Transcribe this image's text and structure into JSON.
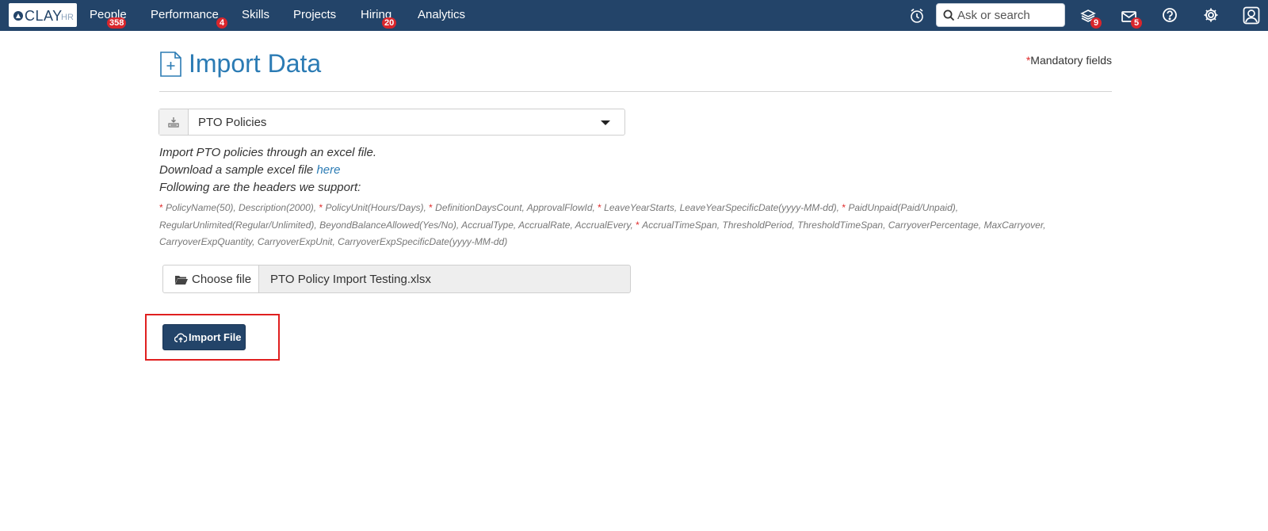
{
  "app": {
    "logo_text": "CLAY",
    "logo_suffix": "HR"
  },
  "nav": {
    "items": [
      {
        "label": "People",
        "badge": "358"
      },
      {
        "label": "Performance",
        "badge": "4"
      },
      {
        "label": "Skills",
        "badge": ""
      },
      {
        "label": "Projects",
        "badge": ""
      },
      {
        "label": "Hiring",
        "badge": "20"
      },
      {
        "label": "Analytics",
        "badge": ""
      }
    ],
    "search_placeholder": "Ask or search",
    "icons": [
      {
        "name": "alarm-clock-icon",
        "badge": ""
      },
      {
        "name": "layers-icon",
        "badge": "9"
      },
      {
        "name": "mail-icon",
        "badge": "5"
      },
      {
        "name": "help-icon",
        "badge": ""
      },
      {
        "name": "gear-icon",
        "badge": ""
      },
      {
        "name": "user-icon",
        "badge": ""
      }
    ]
  },
  "page": {
    "title": "Import Data",
    "mandatory_star": "*",
    "mandatory_label": "Mandatory fields"
  },
  "form": {
    "import_type": "PTO Policies",
    "desc_line1": "Import PTO policies through an excel file.",
    "desc_line2_prefix": "Download a sample excel file ",
    "desc_line2_link": "here",
    "desc_line3": "Following are the headers we support:",
    "headers": [
      {
        "required": true,
        "text": "PolicyName(50), "
      },
      {
        "required": false,
        "text": "Description(2000), "
      },
      {
        "required": true,
        "text": "PolicyUnit(Hours/Days), "
      },
      {
        "required": true,
        "text": "DefinitionDaysCount, ApprovalFlowId, "
      },
      {
        "required": true,
        "text": "LeaveYearStarts, LeaveYearSpecificDate(yyyy-MM-dd), "
      },
      {
        "required": true,
        "text": "PaidUnpaid(Paid/Unpaid), RegularUnlimited(Regular/Unlimited), BeyondBalanceAllowed(Yes/No), AccrualType, AccrualRate, AccrualEvery, "
      },
      {
        "required": true,
        "text": "AccrualTimeSpan, ThresholdPeriod, ThresholdTimeSpan, CarryoverPercentage, MaxCarryover, CarryoverExpQuantity, CarryoverExpUnit, CarryoverExpSpecificDate(yyyy-MM-dd)"
      }
    ],
    "choose_file_label": "Choose file",
    "file_name": "PTO Policy Import Testing.xlsx",
    "import_button_label": "Import File"
  },
  "colors": {
    "nav_bg": "#234469",
    "title_blue": "#2b7bb4",
    "badge_red": "#d9262c",
    "highlight_red": "#e01f1f"
  }
}
